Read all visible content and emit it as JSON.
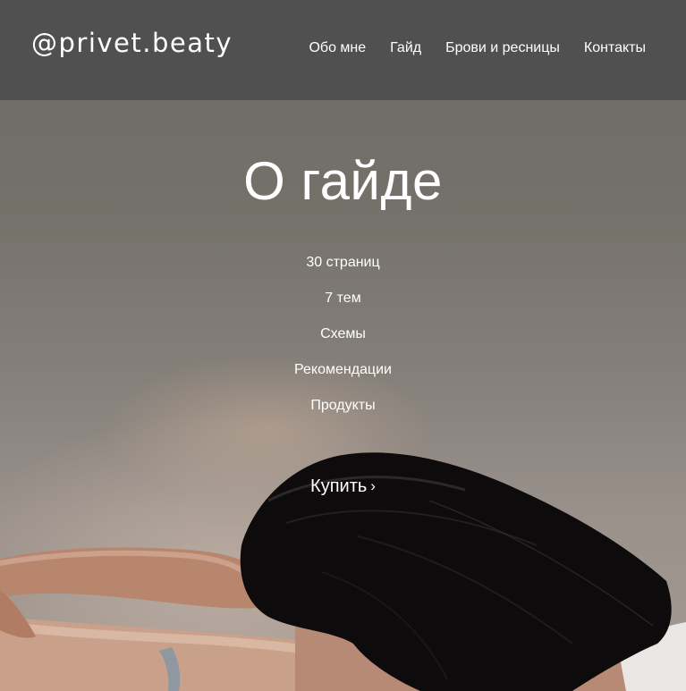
{
  "header": {
    "logo": "@privet.beaty",
    "nav": [
      {
        "label": "Обо мне"
      },
      {
        "label": "Гайд"
      },
      {
        "label": "Брови и ресницы"
      },
      {
        "label": "Контакты"
      }
    ]
  },
  "hero": {
    "title": "О гайде",
    "features": [
      "30 страниц",
      "7 тем",
      "Схемы",
      "Рекомендации",
      "Продукты"
    ],
    "cta_label": "Купить",
    "cta_chevron": "›"
  },
  "colors": {
    "header_bg": "#505050",
    "text": "#ffffff",
    "hair": "#0d0b0b",
    "skin": "#c9a08a"
  },
  "icons": {
    "cta": "chevron-right-icon"
  }
}
